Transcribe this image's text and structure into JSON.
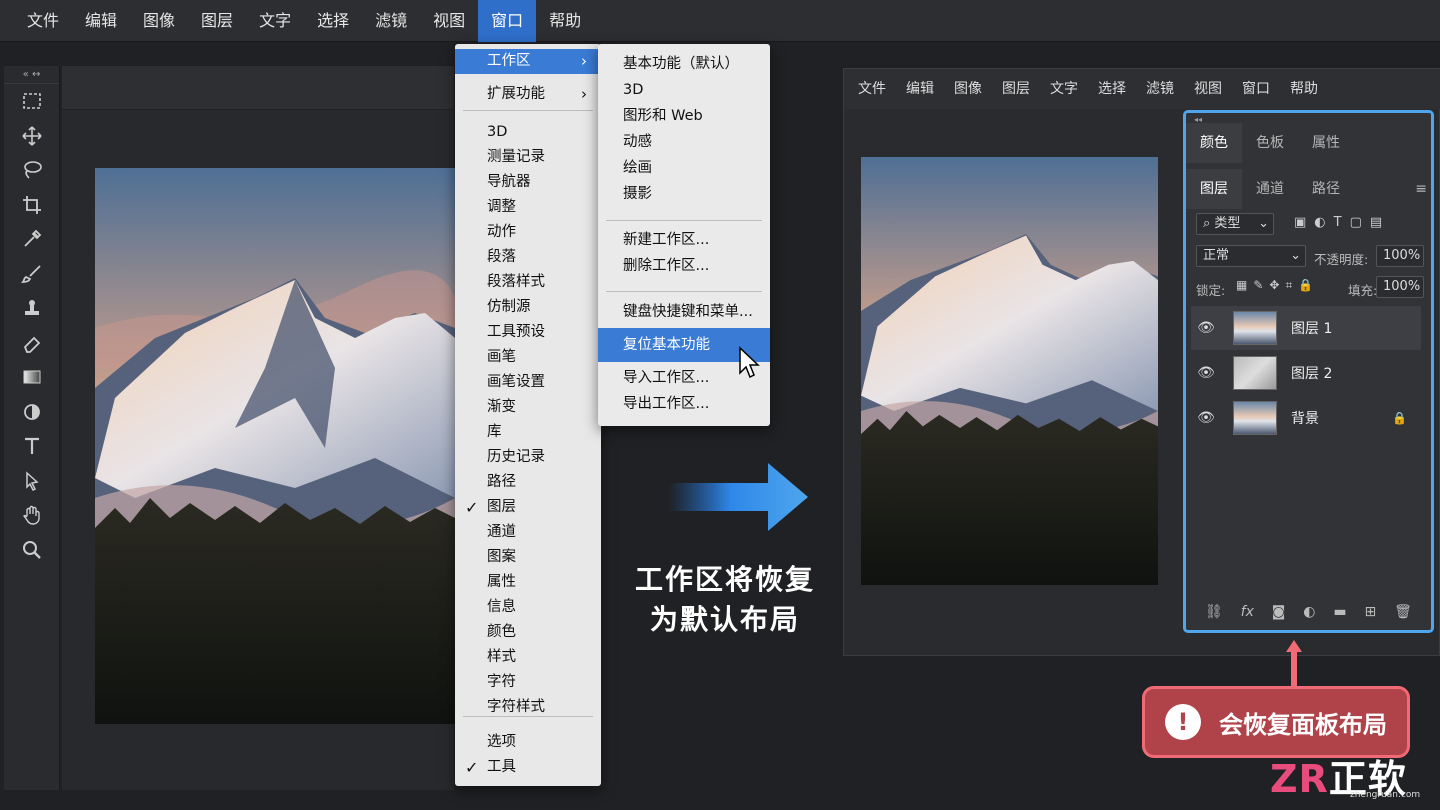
{
  "menubar": {
    "items": [
      "文件",
      "编辑",
      "图像",
      "图层",
      "文字",
      "选择",
      "滤镜",
      "视图",
      "窗口",
      "帮助"
    ],
    "active": "窗口"
  },
  "window_menu": {
    "items": [
      {
        "label": "工作区",
        "submenu": true,
        "highlighted": true
      },
      {
        "label": "扩展功能",
        "submenu": true
      },
      {
        "label": "3D"
      },
      {
        "label": "测量记录"
      },
      {
        "label": "导航器"
      },
      {
        "label": "调整"
      },
      {
        "label": "动作"
      },
      {
        "label": "段落"
      },
      {
        "label": "段落样式"
      },
      {
        "label": "仿制源"
      },
      {
        "label": "工具预设"
      },
      {
        "label": "画笔"
      },
      {
        "label": "画笔设置"
      },
      {
        "label": "渐变"
      },
      {
        "label": "库"
      },
      {
        "label": "历史记录"
      },
      {
        "label": "路径"
      },
      {
        "label": "图层",
        "checked": true
      },
      {
        "label": "通道"
      },
      {
        "label": "图案"
      },
      {
        "label": "属性"
      },
      {
        "label": "信息"
      },
      {
        "label": "颜色"
      },
      {
        "label": "样式"
      },
      {
        "label": "字符"
      },
      {
        "label": "字符样式"
      },
      {
        "label": "选项"
      },
      {
        "label": "工具",
        "checked": true
      }
    ]
  },
  "workspace_submenu": {
    "items": [
      {
        "label": "基本功能（默认）"
      },
      {
        "label": "3D"
      },
      {
        "label": "图形和 Web"
      },
      {
        "label": "动感"
      },
      {
        "label": "绘画"
      },
      {
        "label": "摄影"
      },
      {
        "label": "新建工作区..."
      },
      {
        "label": "删除工作区..."
      },
      {
        "label": "键盘快捷键和菜单..."
      },
      {
        "label": "复位基本功能",
        "highlighted": true
      },
      {
        "label": "导入工作区..."
      },
      {
        "label": "导出工作区..."
      }
    ]
  },
  "caption": {
    "line1": "工作区将恢复",
    "line2": "为默认布局"
  },
  "after_window": {
    "menubar": [
      "文件",
      "编辑",
      "图像",
      "图层",
      "文字",
      "选择",
      "滤镜",
      "视图",
      "窗口",
      "帮助"
    ],
    "panel": {
      "top_tabs": [
        "颜色",
        "色板",
        "属性"
      ],
      "layer_tabs": [
        "图层",
        "通道",
        "路径"
      ],
      "filter_kind": "类型",
      "blend_mode": "正常",
      "opacity_label": "不透明度:",
      "opacity_value": "100%",
      "lock_label": "锁定:",
      "fill_label": "填充:",
      "fill_value": "100%",
      "layers": [
        {
          "name": "图层 1",
          "selected": true
        },
        {
          "name": "图层 2"
        },
        {
          "name": "背景",
          "locked": true
        }
      ]
    }
  },
  "warning": {
    "text": "会恢复面板布局",
    "icon": "exclamation-icon"
  },
  "watermark": {
    "brand": "ZR正软",
    "site": "zhengruan.com"
  },
  "colors": {
    "accent": "#3a7bd5",
    "panel_outline": "#4fa6ec",
    "warning_bg": "#b0424a",
    "warning_border": "#f06b75"
  }
}
